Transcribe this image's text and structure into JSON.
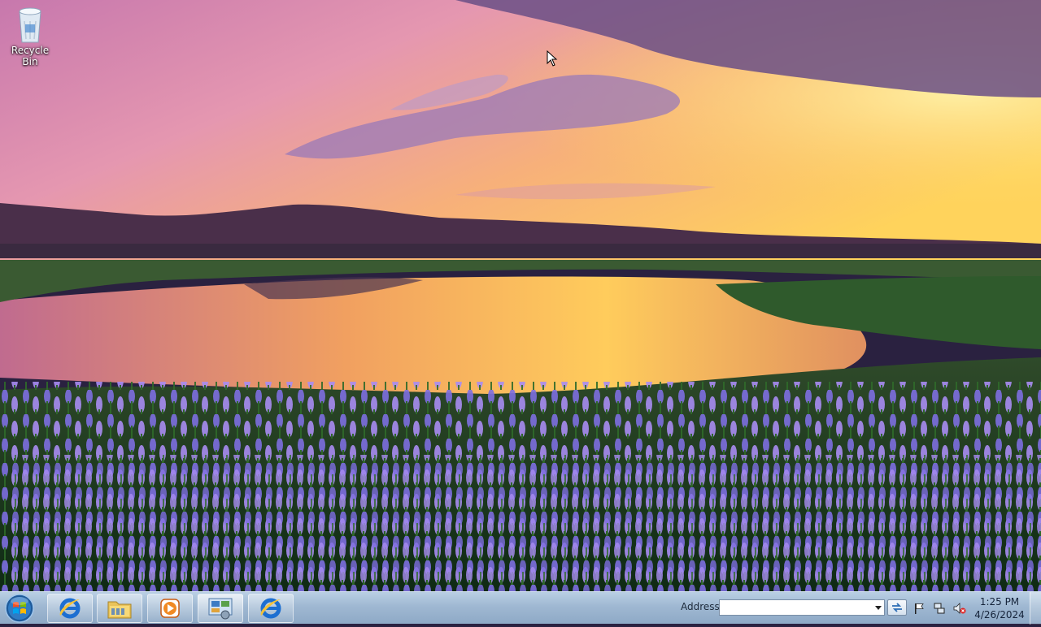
{
  "desktop": {
    "icons": [
      {
        "label": "Recycle Bin",
        "icon": "recycle-bin-icon"
      }
    ]
  },
  "taskbar": {
    "start": {
      "icon": "windows-start-orb-icon"
    },
    "pinned": [
      {
        "icon": "internet-explorer-icon"
      },
      {
        "icon": "file-explorer-icon"
      },
      {
        "icon": "media-player-icon"
      },
      {
        "icon": "control-panel-icon"
      },
      {
        "icon": "internet-explorer-icon"
      }
    ],
    "address": {
      "label": "Address",
      "value": "",
      "placeholder": ""
    },
    "tray": [
      {
        "icon": "action-center-flag-icon"
      },
      {
        "icon": "network-icon"
      },
      {
        "icon": "volume-muted-icon"
      }
    ],
    "clock": {
      "time": "1:25 PM",
      "date": "4/26/2024"
    }
  },
  "colors": {
    "taskbar_top": "#b9cfe4",
    "taskbar_bottom": "#8ea9c6",
    "sky_purple": "#a06aa8",
    "sky_gold": "#ffcf5a",
    "flowers": "#8f78e6"
  }
}
